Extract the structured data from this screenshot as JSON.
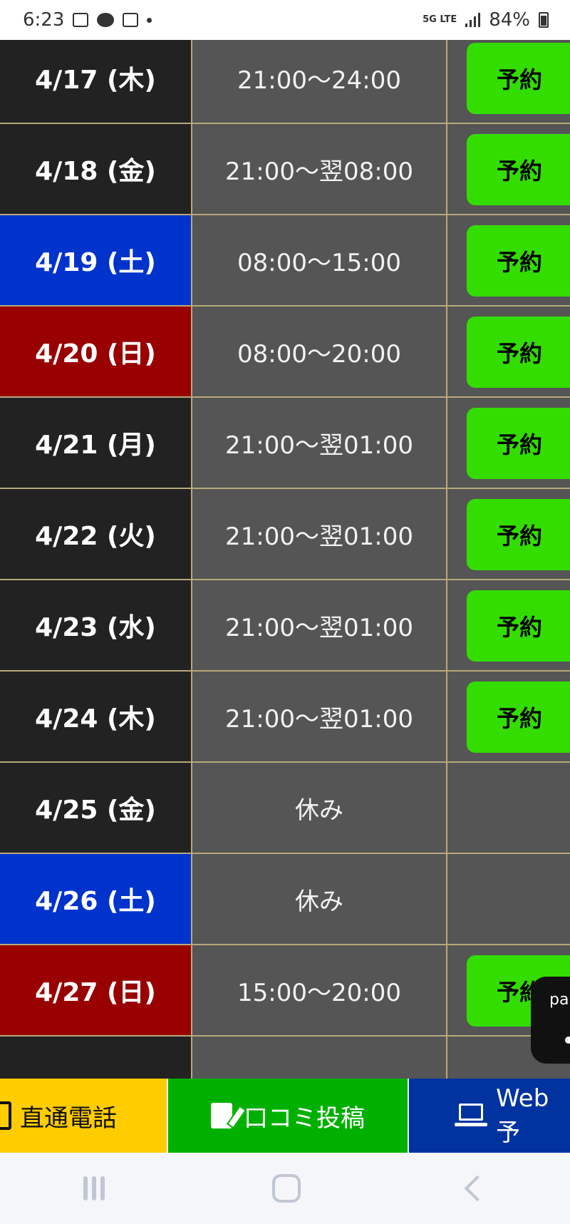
{
  "status_bar": {
    "time": "6:23",
    "network": "5G LTE",
    "battery": "84%"
  },
  "colors": {
    "weekday_bg": "#222222",
    "saturday_bg": "#0033cc",
    "sunday_bg": "#990000",
    "time_bg": "#555555",
    "reserve_button": "#33dd00"
  },
  "schedule": {
    "reserve_label": "予約",
    "rows": [
      {
        "date": "4/17 (木)",
        "day_type": "weekday",
        "time": "21:00〜24:00",
        "bookable": true
      },
      {
        "date": "4/18 (金)",
        "day_type": "weekday",
        "time": "21:00〜翌08:00",
        "bookable": true
      },
      {
        "date": "4/19 (土)",
        "day_type": "saturday",
        "time": "08:00〜15:00",
        "bookable": true
      },
      {
        "date": "4/20 (日)",
        "day_type": "sunday",
        "time": "08:00〜20:00",
        "bookable": true
      },
      {
        "date": "4/21 (月)",
        "day_type": "weekday",
        "time": "21:00〜翌01:00",
        "bookable": true
      },
      {
        "date": "4/22 (火)",
        "day_type": "weekday",
        "time": "21:00〜翌01:00",
        "bookable": true
      },
      {
        "date": "4/23 (水)",
        "day_type": "weekday",
        "time": "21:00〜翌01:00",
        "bookable": true
      },
      {
        "date": "4/24 (木)",
        "day_type": "weekday",
        "time": "21:00〜翌01:00",
        "bookable": true
      },
      {
        "date": "4/25 (金)",
        "day_type": "weekday",
        "time": "休み",
        "bookable": false
      },
      {
        "date": "4/26 (土)",
        "day_type": "saturday",
        "time": "休み",
        "bookable": false
      },
      {
        "date": "4/27 (日)",
        "day_type": "sunday",
        "time": "15:00〜20:00",
        "bookable": true
      }
    ]
  },
  "floating_pill": {
    "label": "pa"
  },
  "bottom_bar": {
    "phone_label": "直通電話",
    "review_label": "口コミ投稿",
    "web_label": "Web予"
  }
}
